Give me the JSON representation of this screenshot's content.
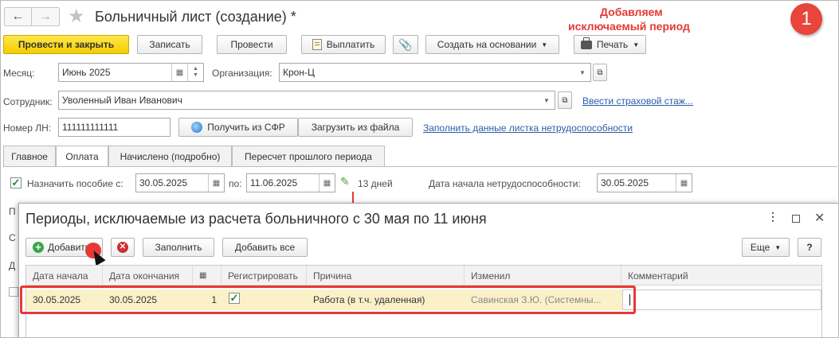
{
  "window": {
    "title": "Больничный лист (создание) *"
  },
  "annotation": {
    "line1": "Добавляем",
    "line2": "исключаемый период",
    "badge": "1"
  },
  "toolbar": {
    "post_close": "Провести и закрыть",
    "save": "Записать",
    "post": "Провести",
    "pay": "Выплатить",
    "create_based": "Создать на основании",
    "print": "Печать"
  },
  "form": {
    "month_label": "Месяц:",
    "month_value": "Июнь 2025",
    "org_label": "Организация:",
    "org_value": "Крон-Ц",
    "employee_label": "Сотрудник:",
    "employee_value": "Уволенный Иван Иванович",
    "insurance_link": "Ввести страховой стаж...",
    "ln_label": "Номер ЛН:",
    "ln_value": "111111111111",
    "get_sfr": "Получить из СФР",
    "load_file": "Загрузить из файла",
    "fill_link": "Заполнить данные листка нетрудоспособности"
  },
  "tabs": [
    "Главное",
    "Оплата",
    "Начислено (подробно)",
    "Пересчет прошлого периода"
  ],
  "pay": {
    "assign_label": "Назначить пособие  с:",
    "from_value": "30.05.2025",
    "to_label": "по:",
    "to_value": "11.06.2025",
    "days": "13 дней",
    "start_label": "Дата начала нетрудоспособности:",
    "start_value": "30.05.2025"
  },
  "dialog": {
    "title": "Периоды, исключаемые из расчета больничного с 30 мая по 11 июня",
    "add": "Добавить",
    "fill": "Заполнить",
    "add_all": "Добавить все",
    "more": "Еще",
    "help": "?",
    "columns": [
      "Дата начала",
      "Дата окончания",
      "",
      "Регистрировать",
      "Причина",
      "Изменил",
      "Комментарий"
    ],
    "row": {
      "start": "30.05.2025",
      "end": "30.05.2025",
      "num": "1",
      "reason": "Работа (в т.ч. удаленная)",
      "changed_by": "Савинская З.Ю. (Системны..."
    }
  },
  "side_letters": [
    "П",
    "С",
    "Д"
  ]
}
